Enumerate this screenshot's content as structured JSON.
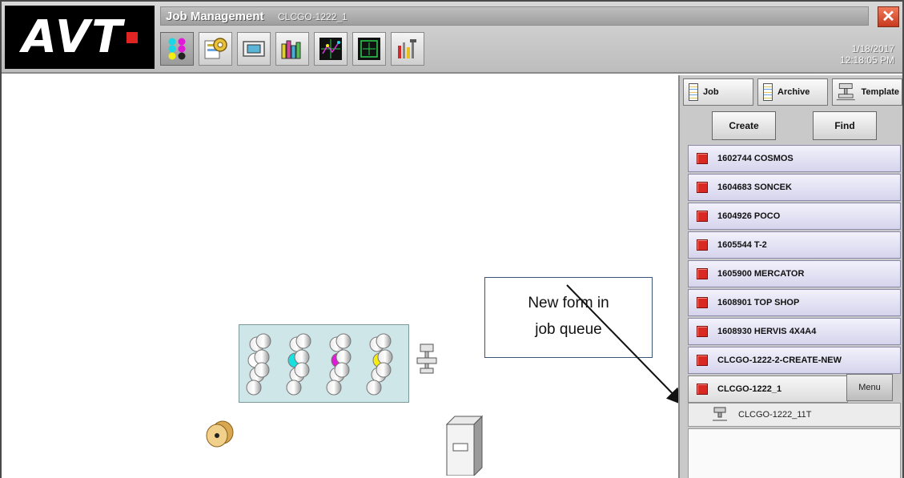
{
  "app": {
    "logo_text": "AVT",
    "title": "Job Management",
    "job_name": "CLCGO-1222_1",
    "close_label": "✕",
    "date": "1/18/2017",
    "time": "12:18:05 PM"
  },
  "toolbar": {
    "items": [
      {
        "name": "color-dots-icon",
        "active": true
      },
      {
        "name": "job-settings-icon",
        "active": false
      },
      {
        "name": "display-icon",
        "active": false
      },
      {
        "name": "bar-chart-icon",
        "active": false
      },
      {
        "name": "register-graph-icon",
        "active": false
      },
      {
        "name": "frame-target-icon",
        "active": false
      },
      {
        "name": "tools-icon",
        "active": false
      }
    ]
  },
  "panel": {
    "tabs": {
      "job": "Job",
      "archive": "Archive",
      "template": "Template"
    },
    "actions": {
      "create": "Create",
      "find": "Find"
    },
    "jobs": [
      "1602744 COSMOS",
      "1604683 SONCEK",
      "1604926 POCO",
      "1605544 T-2",
      "1605900 MERCATOR",
      "1608901 TOP SHOP",
      "1608930 HERVIS 4X4A4",
      "CLCGO-1222-2-CREATE-NEW",
      "CLCGO-1222_1"
    ],
    "menu_label": "Menu",
    "sub_item": "CLCGO-1222_11T"
  },
  "annotation": {
    "line1": "New form in",
    "line2": "job queue"
  },
  "colors": {
    "job_status": "#d82a22",
    "press_bg": "#cfe6e9",
    "cyan": "#18e0e0",
    "magenta": "#e01ad8",
    "yellow": "#f4ee10"
  }
}
